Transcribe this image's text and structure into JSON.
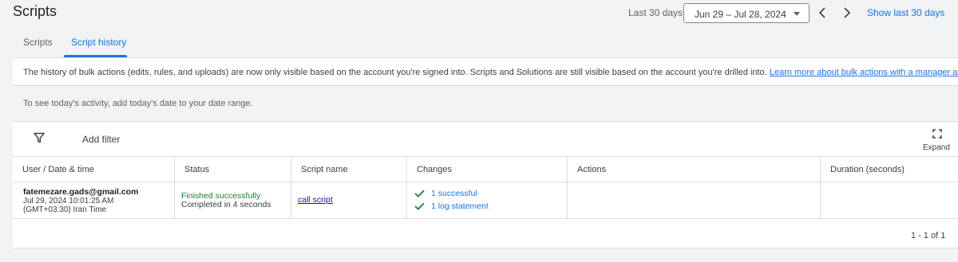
{
  "header": {
    "title": "Scripts",
    "range_label": "Last 30 days",
    "date_range": "Jun 29 – Jul 28, 2024",
    "show_last": "Show last 30 days"
  },
  "tabs": [
    {
      "label": "Scripts",
      "active": false
    },
    {
      "label": "Script history",
      "active": true
    }
  ],
  "notice": {
    "text": "The history of bulk actions (edits, rules, and uploads) are now only visible based on the account you're signed into. Scripts and Solutions are still visible based on the account you're drilled into. ",
    "link": "Learn more about bulk actions with a manager account"
  },
  "today_hint": "To see today's activity, add today's date to your date range.",
  "toolbar": {
    "add_filter": "Add filter",
    "expand": "Expand"
  },
  "table": {
    "columns": [
      "User / Date & time",
      "Status",
      "Script name",
      "Changes",
      "Actions",
      "Duration (seconds)"
    ],
    "rows": [
      {
        "user": "fatemezare.gads@gmail.com",
        "date": "Jul 29, 2024 10:01:25 AM",
        "timezone": "(GMT+03:30) Iran Time",
        "status": "Finished successfully",
        "status_detail": "Completed in 4 seconds",
        "script_name": "call script",
        "changes": [
          "1 successful",
          "1 log statement"
        ],
        "actions": "",
        "duration": ""
      }
    ]
  },
  "pagination": "1 - 1 of 1",
  "colors": {
    "accent": "#1a73e8",
    "success": "#188038",
    "background": "#f1f3f4"
  }
}
